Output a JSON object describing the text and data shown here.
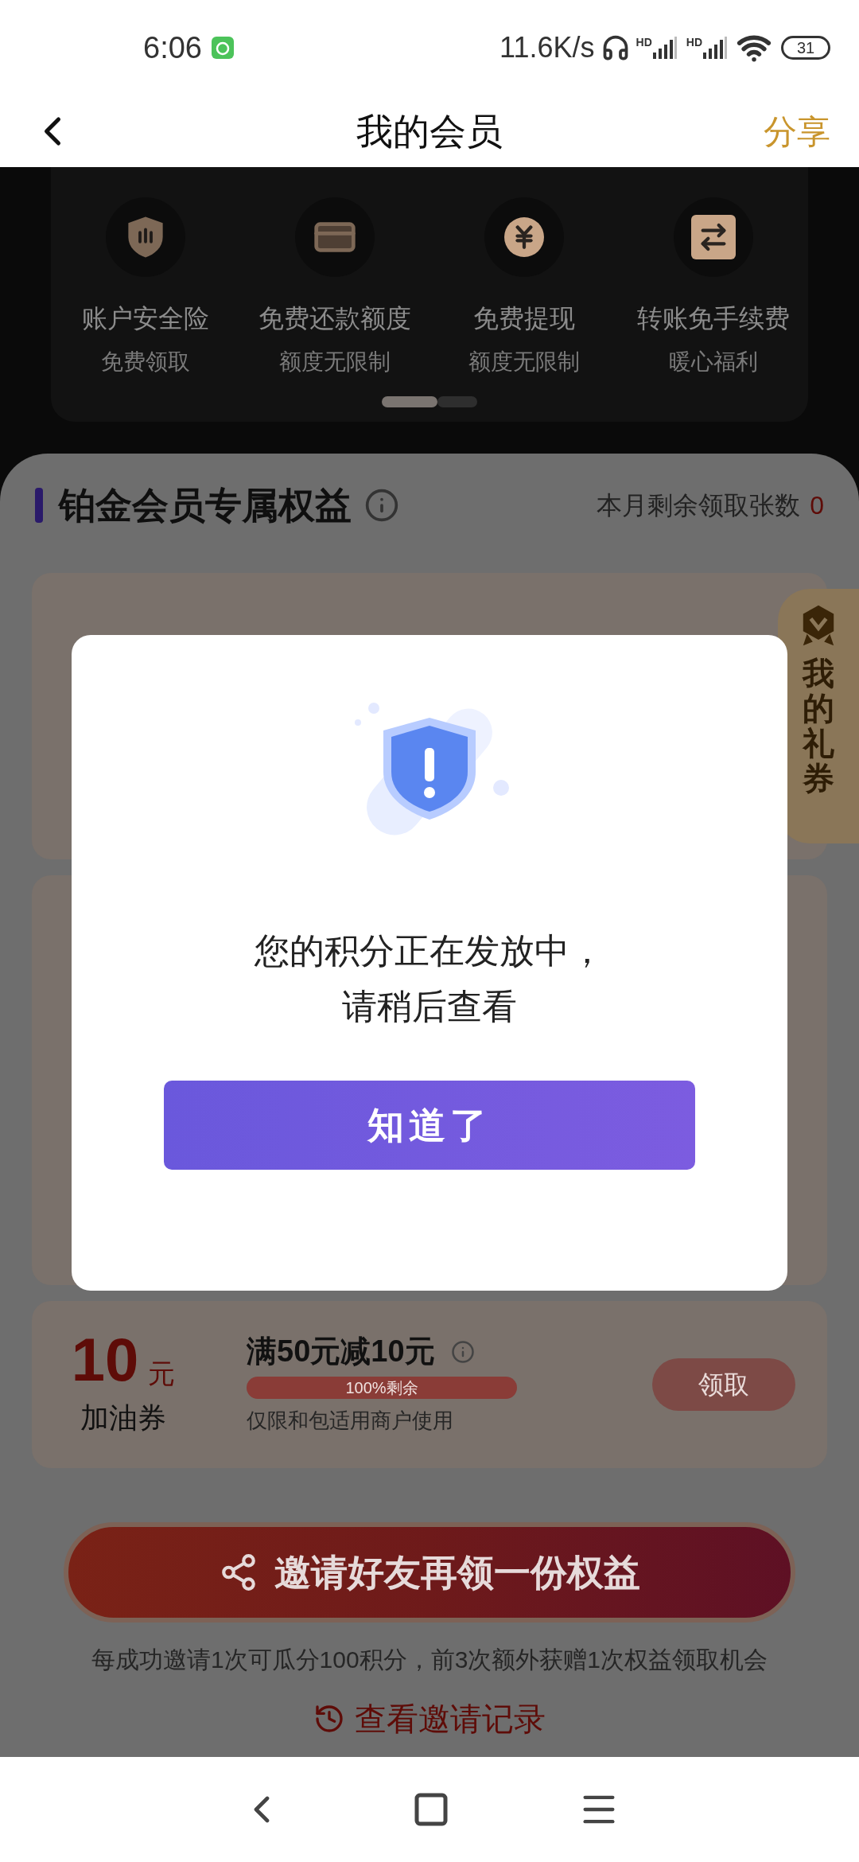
{
  "status_bar": {
    "time": "6:06",
    "speed": "11.6K/s",
    "signal_labels": [
      "HD",
      "HD"
    ],
    "battery": "31"
  },
  "header": {
    "title": "我的会员",
    "action": "分享"
  },
  "features": [
    {
      "label": "账户安全险",
      "sub": "免费领取"
    },
    {
      "label": "免费还款额度",
      "sub": "额度无限制"
    },
    {
      "label": "免费提现",
      "sub": "额度无限制"
    },
    {
      "label": "转账免手续费",
      "sub": "暖心福利"
    }
  ],
  "pager": [
    {
      "selected": true
    },
    {
      "selected": false
    }
  ],
  "benefits": {
    "title": "铂金会员专属权益",
    "remaining_label": "本月剩余领取张数",
    "remaining_count": "0"
  },
  "coupons": [
    {
      "kind": "full",
      "amount": "10",
      "unit": "元",
      "name": "加油券",
      "title": "满50元减10元",
      "level": 1,
      "bar_label": "100%剩余",
      "note": "仅限和包适用商户使用",
      "button": "领取"
    }
  ],
  "gift_tab": {
    "label": "我的礼券"
  },
  "invite": {
    "button": "邀请好友再领一份权益",
    "note": "每成功邀请1次可瓜分100积分，前3次额外获赠1次权益领取机会",
    "record_link": "查看邀请记录"
  },
  "dialog": {
    "lines": [
      "您的积分正在发放中，",
      "请稍后查看"
    ],
    "button": "知道了"
  }
}
